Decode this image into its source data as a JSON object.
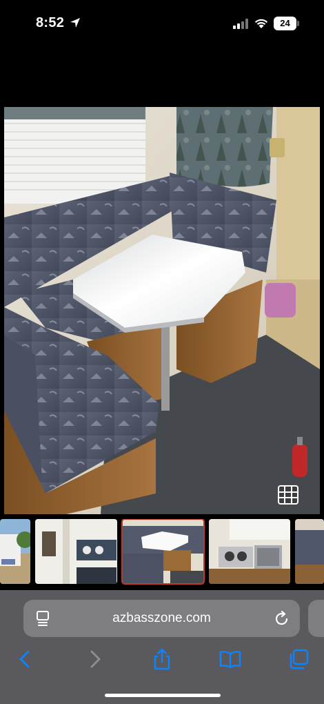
{
  "status_bar": {
    "time": "8:52",
    "battery_level": "24",
    "icons": [
      "location-arrow-icon",
      "cellular-signal-icon",
      "wifi-icon",
      "battery-icon"
    ]
  },
  "main_photo": {
    "subject": "rv-dinette-booth-with-table",
    "grid_icon": "grid-icon"
  },
  "thumbnails": [
    {
      "name": "rv-exterior",
      "selected": false
    },
    {
      "name": "rv-control-panel",
      "selected": false
    },
    {
      "name": "rv-dinette",
      "selected": true
    },
    {
      "name": "rv-kitchen-stove-sink",
      "selected": false
    },
    {
      "name": "rv-seating",
      "selected": false
    }
  ],
  "browser": {
    "url": "azbasszone.com",
    "icons": [
      "page-menu-icon",
      "reload-icon",
      "back-icon",
      "forward-icon",
      "share-icon",
      "bookmarks-icon",
      "tabs-icon"
    ]
  },
  "colors": {
    "toolbar_background": "#5a5a5e",
    "address_bar": "#7d7d82",
    "accent_blue": "#0a84ff",
    "selected_thumb_border": "#c0392b"
  }
}
